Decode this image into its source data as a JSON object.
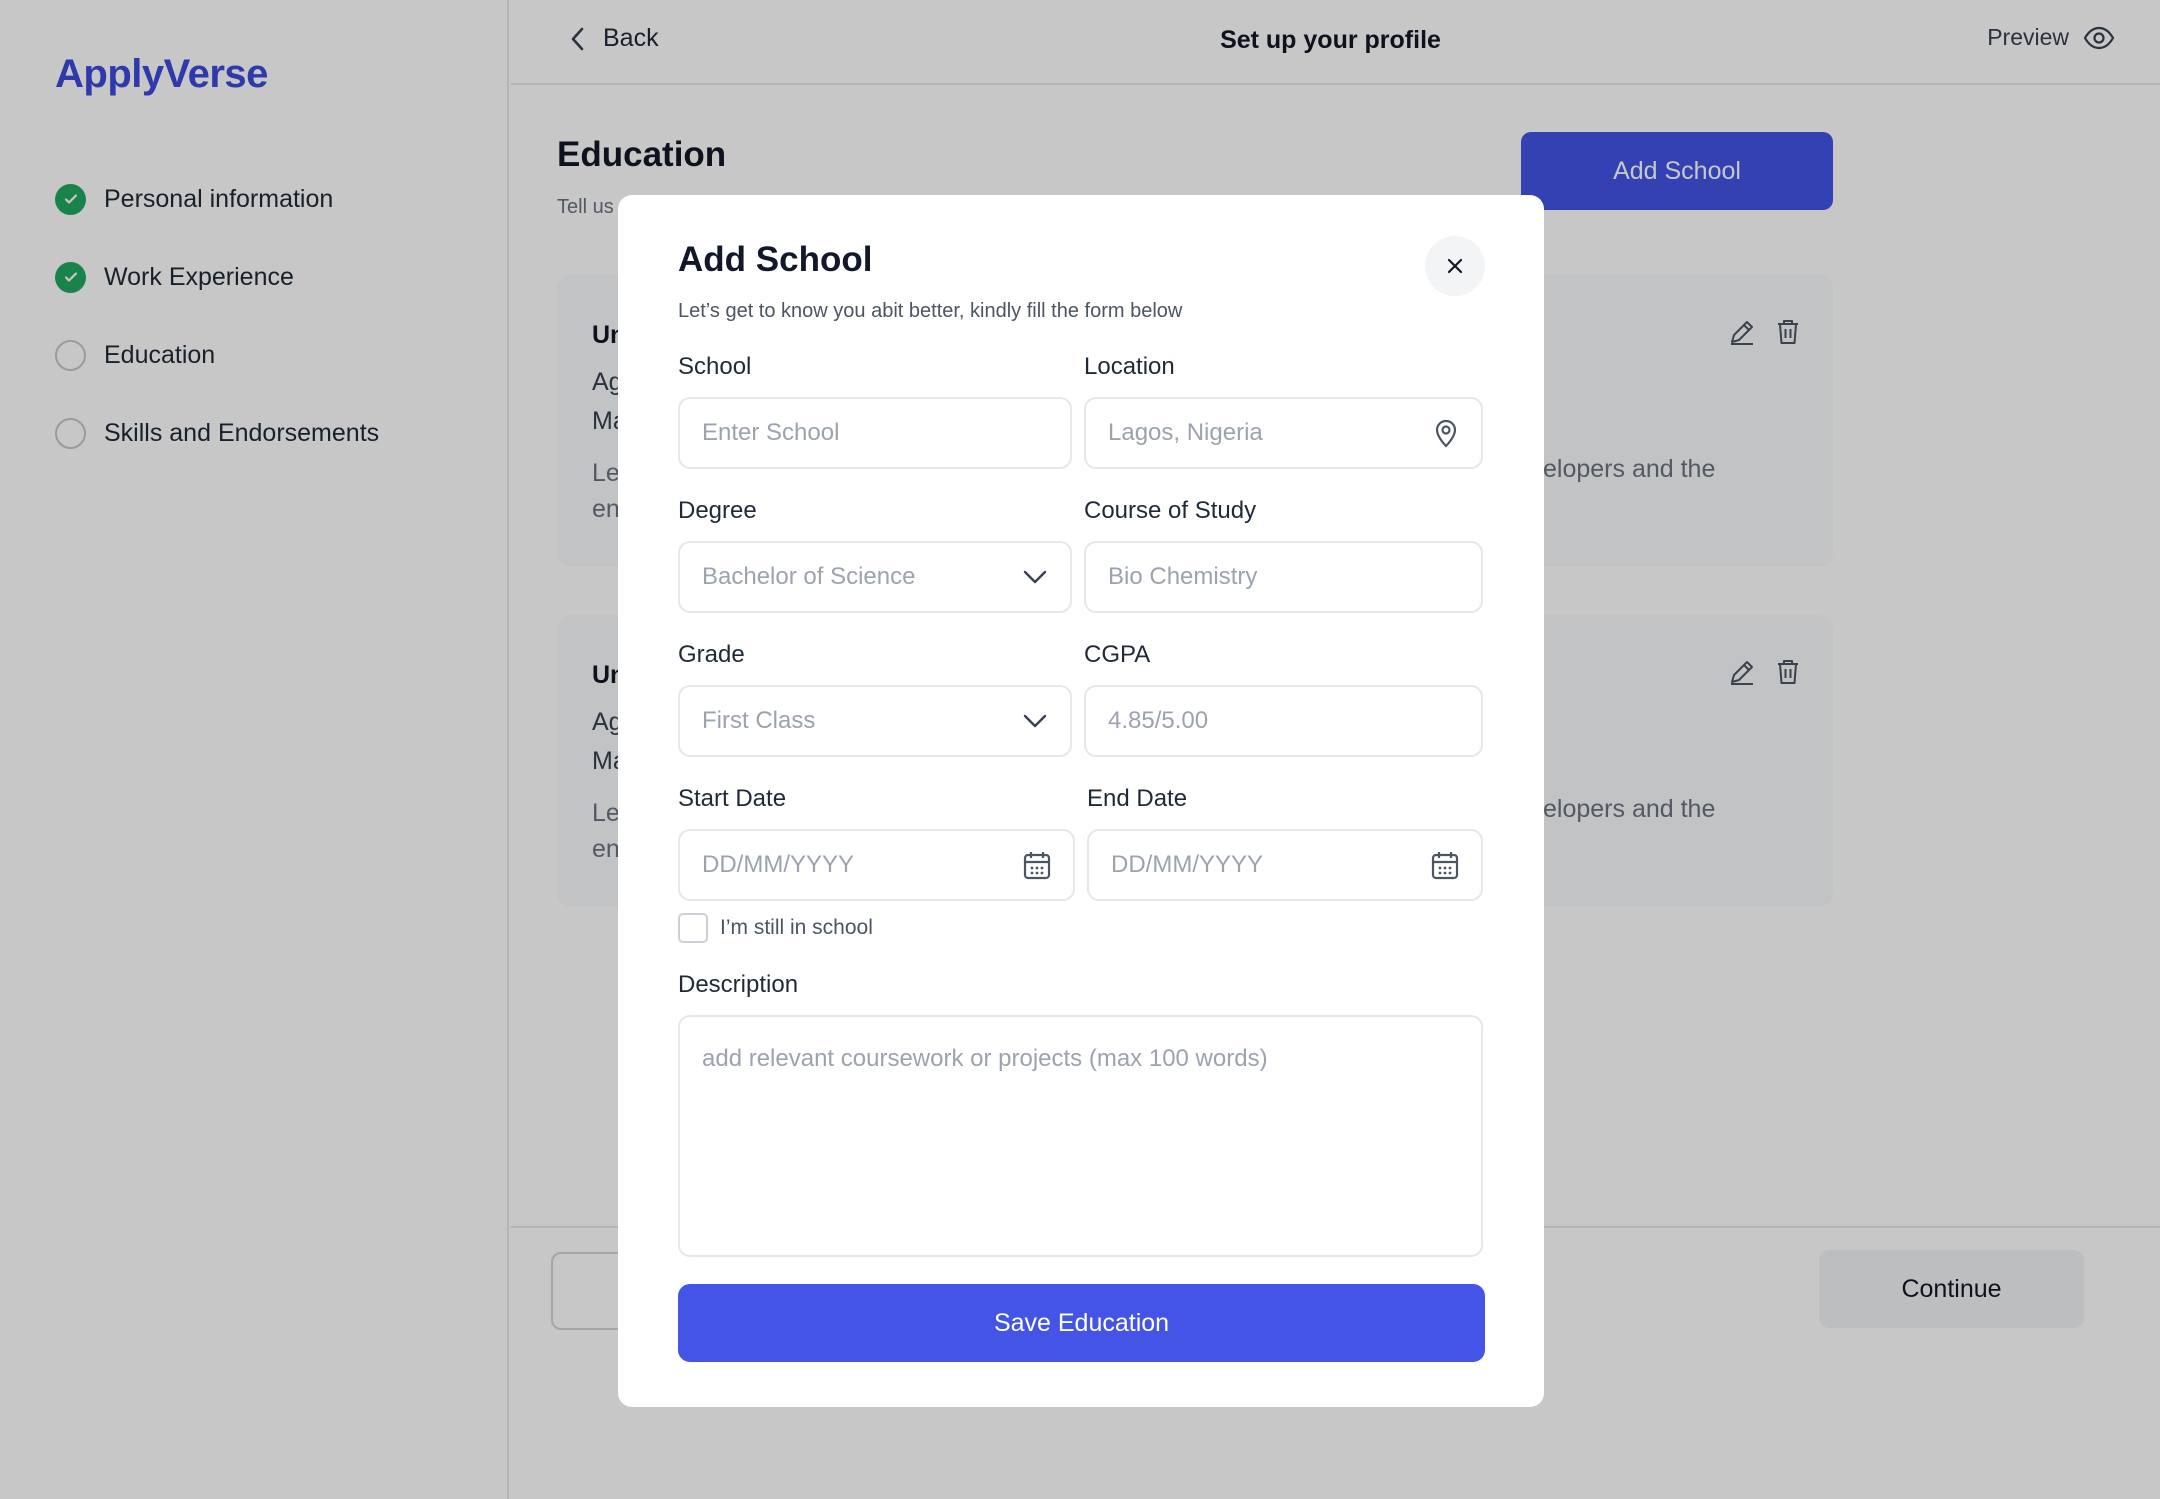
{
  "app": {
    "brand": "ApplyVerse"
  },
  "sidebar": {
    "steps": [
      {
        "label": "Personal information",
        "status": "done"
      },
      {
        "label": "Work Experience",
        "status": "done"
      },
      {
        "label": "Education",
        "status": "pending"
      },
      {
        "label": "Skills and Endorsements",
        "status": "pending"
      }
    ]
  },
  "header": {
    "back_label": "Back",
    "title": "Set up your profile",
    "preview_label": "Preview"
  },
  "main": {
    "section_title": "Education",
    "section_subtitle": "Tell us",
    "add_school_label": "Add School",
    "cards": [
      {
        "title": "Un",
        "line1": "Ag",
        "line2": "Ma",
        "desc": "Le",
        "desc2": "en",
        "tail": "elopers and the"
      },
      {
        "title": "Un",
        "line1": "Ag",
        "line2": "Ma",
        "desc": "Le",
        "desc2": "en",
        "tail": "elopers and the"
      }
    ]
  },
  "footer": {
    "continue_label": "Continue"
  },
  "modal": {
    "title": "Add School",
    "subtitle": "Let’s get to know you abit better, kindly fill the form below",
    "fields": {
      "school": {
        "label": "School",
        "placeholder": "Enter School"
      },
      "location": {
        "label": "Location",
        "placeholder": "Lagos, Nigeria"
      },
      "degree": {
        "label": "Degree",
        "value": "Bachelor of Science"
      },
      "course": {
        "label": "Course of Study",
        "placeholder": "Bio Chemistry"
      },
      "grade": {
        "label": "Grade",
        "value": "First Class"
      },
      "cgpa": {
        "label": "CGPA",
        "placeholder": "4.85/5.00"
      },
      "start_date": {
        "label": "Start Date",
        "placeholder": "DD/MM/YYYY"
      },
      "end_date": {
        "label": "End Date",
        "placeholder": "DD/MM/YYYY"
      },
      "still_in_school": {
        "label": "I’m still in school",
        "checked": false
      },
      "description": {
        "label": "Description",
        "placeholder": "add relevant coursework or projects (max 100 words)"
      }
    },
    "save_label": "Save Education"
  },
  "colors": {
    "accent": "#4354e6",
    "brand": "#3b4bdb",
    "success": "#22a861"
  },
  "icons": [
    "chevron-left-icon",
    "eye-icon",
    "check-icon",
    "edit-icon",
    "trash-icon",
    "close-icon",
    "location-pin-icon",
    "chevron-down-icon",
    "calendar-icon"
  ]
}
